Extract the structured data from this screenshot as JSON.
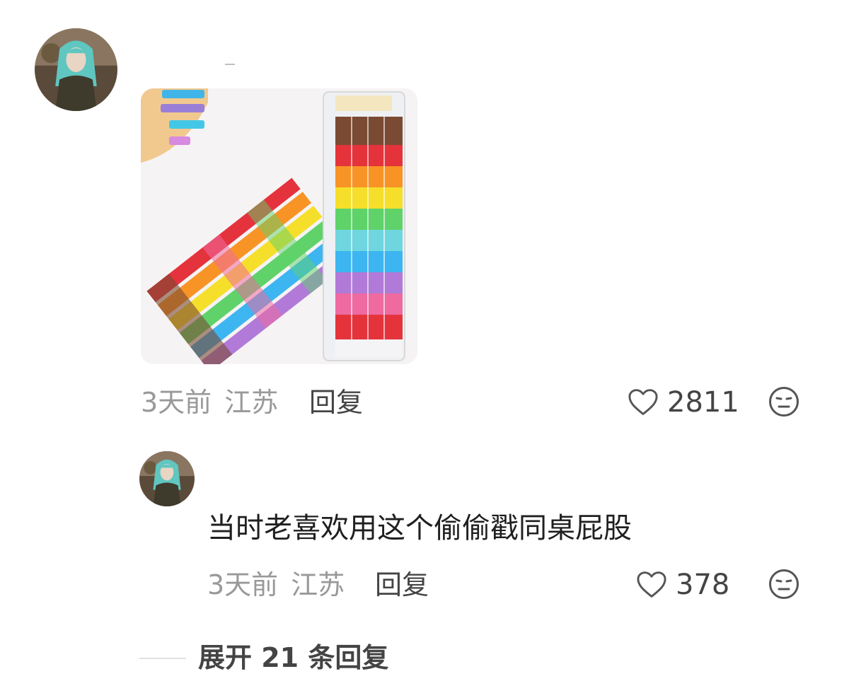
{
  "comment": {
    "avatar": "anime-character-avatar",
    "image": "rainbow-stacking-pencils-photo",
    "time": "3天前",
    "location": "江苏",
    "reply_label": "回复",
    "likes": "2811",
    "like_icon": "heart-outline-icon",
    "react_icon": "neutral-face-icon"
  },
  "reply": {
    "avatar": "anime-character-avatar",
    "text": "当时老喜欢用这个偷偷戳同桌屁股",
    "time": "3天前",
    "location": "江苏",
    "reply_label": "回复",
    "likes": "378",
    "like_icon": "heart-outline-icon",
    "react_icon": "neutral-face-icon"
  },
  "expand_label": "展开 21 条回复",
  "colors": {
    "meta_text": "#999999",
    "body_text": "#1f1f1f",
    "action_text": "#444444"
  }
}
